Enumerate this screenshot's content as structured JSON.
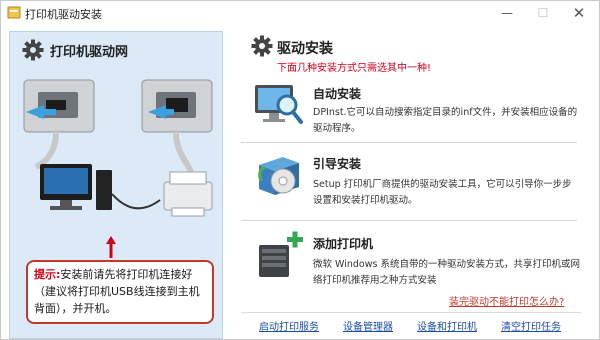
{
  "window": {
    "title": "打印机驱动安装"
  },
  "left": {
    "title": "打印机驱动网",
    "tip_label": "提示:",
    "tip_text": "安装前请先将打印机连接好（建议将打印机USB线连接到主机背面），并开机。"
  },
  "right": {
    "title": "驱动安装",
    "subtitle": "下面几种安装方式只需选其中一种!",
    "options": [
      {
        "title": "自动安装",
        "desc": "DPInst.它可以自动搜索指定目录的inf文件，并安装相应设备的驱动程序。",
        "icon": "monitor-search-icon"
      },
      {
        "title": "引导安装",
        "desc": "Setup 打印机厂商提供的驱动安装工具，它可以引导你一步步设置和安装打印机驱动。",
        "icon": "setup-box-icon"
      },
      {
        "title": "添加打印机",
        "desc": "微软 Windows 系统自带的一种驱动安装方式，共享打印机或网络打印机推荐用之种方式安装",
        "icon": "add-printer-icon"
      }
    ],
    "help_link": "装完驱动不能打印怎么办?"
  },
  "links": [
    "启动打印服务",
    "设备管理器",
    "设备和打印机",
    "清空打印任务"
  ],
  "colors": {
    "accent_red": "#d0021b",
    "panel_bg": "#dbeaf6",
    "link_blue": "#1f4fa3"
  }
}
